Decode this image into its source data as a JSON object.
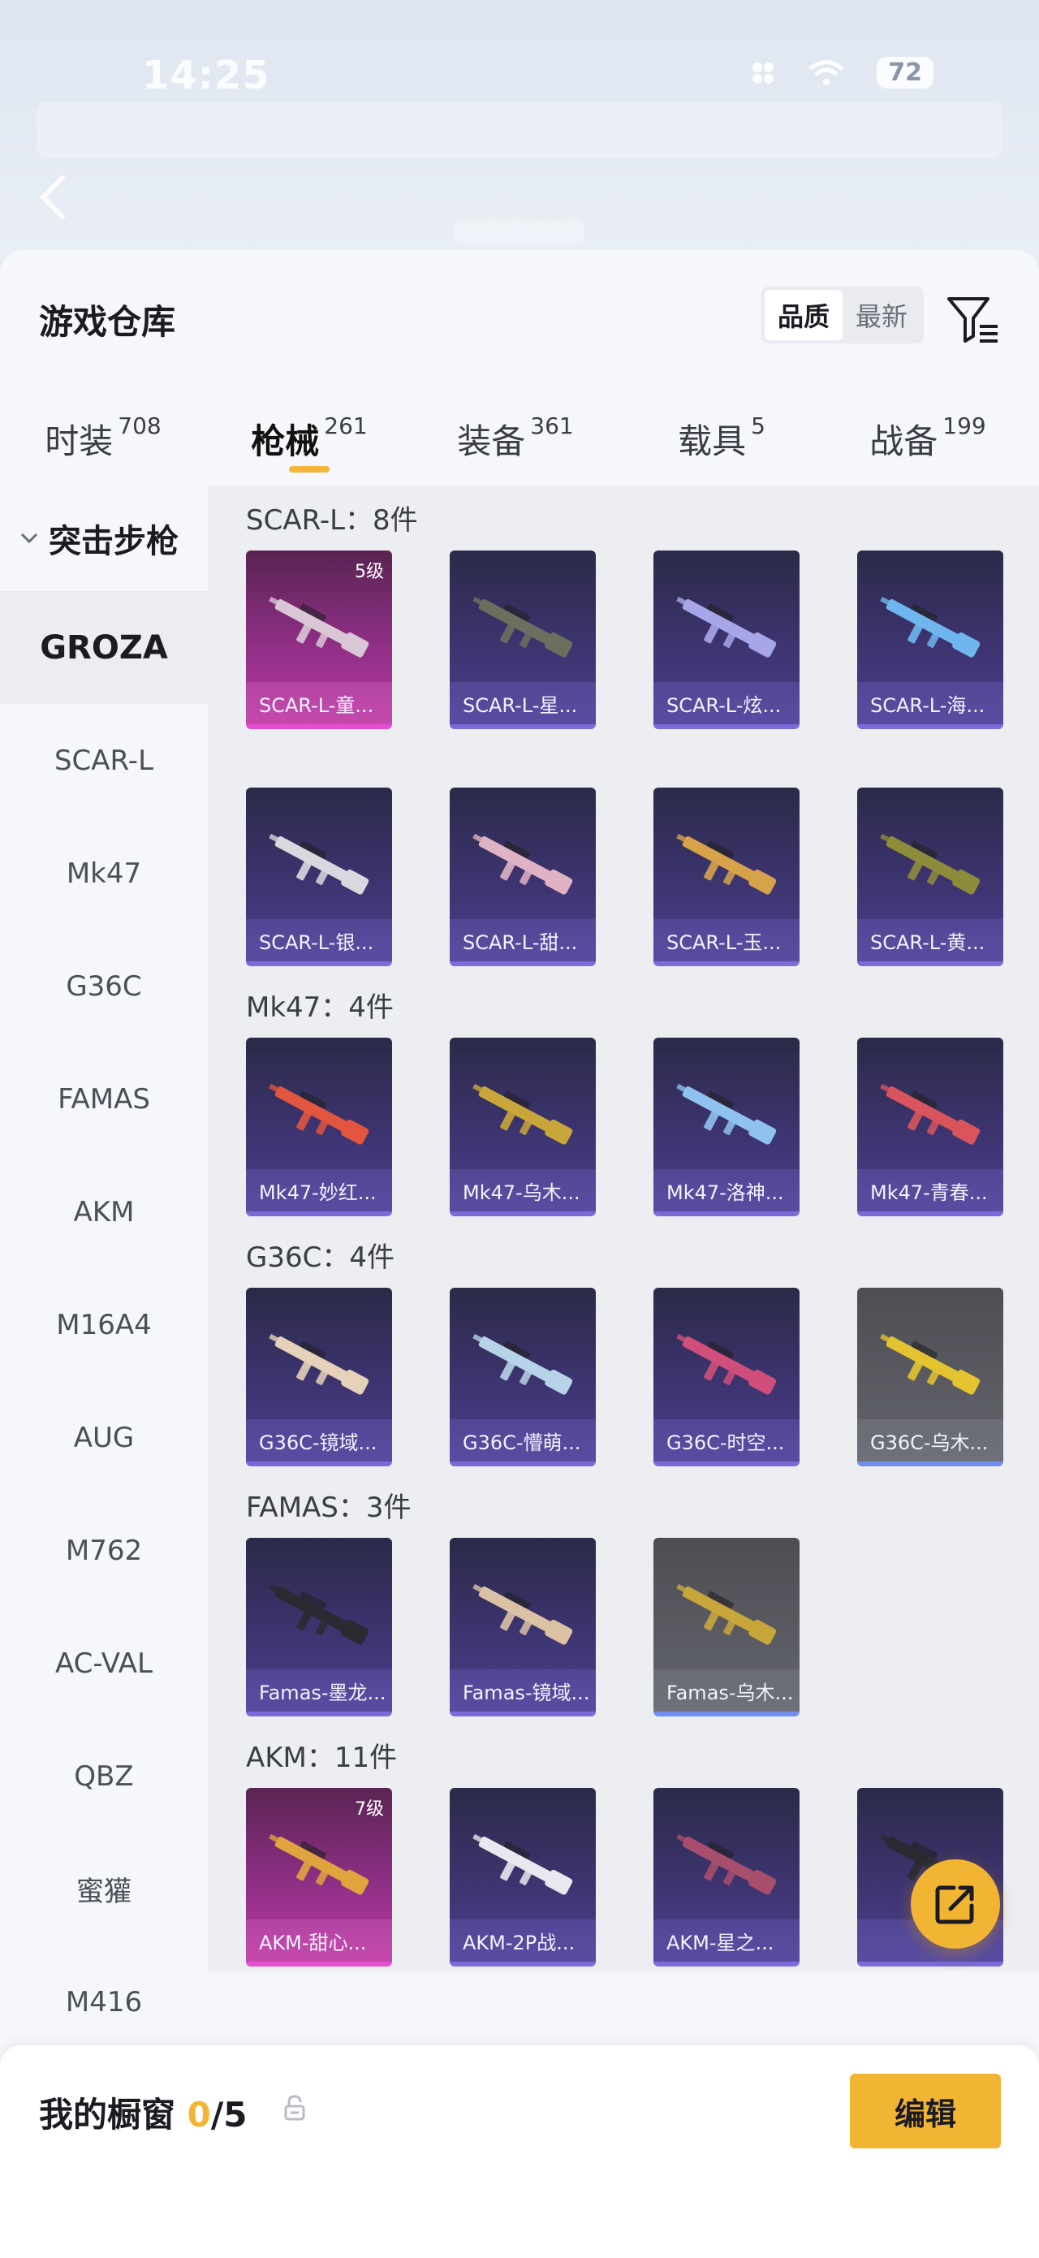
{
  "status_bar": {
    "time": "14:25",
    "battery": "72"
  },
  "header": {
    "title": "游戏仓库",
    "sort_options": [
      "品质",
      "最新"
    ],
    "active_sort": 0
  },
  "tabs": [
    {
      "label": "时装",
      "count": "708"
    },
    {
      "label": "枪械",
      "count": "261"
    },
    {
      "label": "装备",
      "count": "361"
    },
    {
      "label": "载具",
      "count": "5"
    },
    {
      "label": "战备",
      "count": "199"
    }
  ],
  "active_tab": 1,
  "sidebar": {
    "category": "突击步枪",
    "items": [
      "GROZA",
      "SCAR-L",
      "Mk47",
      "G36C",
      "FAMAS",
      "AKM",
      "M16A4",
      "AUG",
      "M762",
      "AC-VAL",
      "QBZ",
      "蜜獾",
      "M416"
    ],
    "active_index": 0
  },
  "groups": [
    {
      "title": "SCAR-L：8件",
      "items": [
        {
          "name": "SCAR-L-童...",
          "tier": "pink",
          "level": "5级",
          "gun_color": "#d9c7d6"
        },
        {
          "name": "SCAR-L-星...",
          "tier": "purple",
          "gun_color": "#6d6f5e"
        },
        {
          "name": "SCAR-L-炫...",
          "tier": "purple",
          "gun_color": "#a7a6e8"
        },
        {
          "name": "SCAR-L-海...",
          "tier": "purple",
          "gun_color": "#6fb6ef"
        },
        {
          "name": "SCAR-L-银...",
          "tier": "purple",
          "gun_color": "#d8d9de"
        },
        {
          "name": "SCAR-L-甜...",
          "tier": "purple",
          "gun_color": "#e0b3c4"
        },
        {
          "name": "SCAR-L-玉...",
          "tier": "purple",
          "gun_color": "#d6a24a"
        },
        {
          "name": "SCAR-L-黄...",
          "tier": "purple",
          "gun_color": "#8d8c3a"
        }
      ]
    },
    {
      "title": "Mk47：4件",
      "items": [
        {
          "name": "Mk47-妙红...",
          "tier": "purple",
          "gun_color": "#e2553f"
        },
        {
          "name": "Mk47-乌木...",
          "tier": "purple",
          "gun_color": "#c9a63a"
        },
        {
          "name": "Mk47-洛神...",
          "tier": "purple",
          "gun_color": "#8fc2ef"
        },
        {
          "name": "Mk47-青春...",
          "tier": "purple",
          "gun_color": "#d9545d"
        }
      ]
    },
    {
      "title": "G36C：4件",
      "items": [
        {
          "name": "G36C-镜域...",
          "tier": "purple",
          "gun_color": "#e5d2b8"
        },
        {
          "name": "G36C-懵萌...",
          "tier": "purple",
          "gun_color": "#b7d3e8"
        },
        {
          "name": "G36C-时空...",
          "tier": "purple",
          "gun_color": "#cf4f7a"
        },
        {
          "name": "G36C-乌木...",
          "tier": "gray",
          "gun_color": "#e4c331"
        }
      ]
    },
    {
      "title": "FAMAS：3件",
      "items": [
        {
          "name": "Famas-墨龙...",
          "tier": "purple",
          "gun_color": "#2a2a30"
        },
        {
          "name": "Famas-镜域...",
          "tier": "purple",
          "gun_color": "#dcc2a5"
        },
        {
          "name": "Famas-乌木...",
          "tier": "gray",
          "gun_color": "#c9a63a"
        }
      ]
    },
    {
      "title": "AKM：11件",
      "items": [
        {
          "name": "AKM-甜心...",
          "tier": "pink",
          "level": "7级",
          "gun_color": "#e0a33e"
        },
        {
          "name": "AKM-2P战...",
          "tier": "purple",
          "gun_color": "#e8e8ee"
        },
        {
          "name": "AKM-星之...",
          "tier": "purple",
          "gun_color": "#a84e6d"
        },
        {
          "name": "",
          "tier": "purple",
          "gun_color": "#2a2a30"
        }
      ]
    }
  ],
  "showcase": {
    "label": "我的橱窗",
    "count": "0",
    "total": "/5",
    "edit_label": "编辑"
  },
  "colors": {
    "accent": "#f2b533",
    "pink_tier": "#e44fd2",
    "purple_tier": "#7a6bd8"
  }
}
